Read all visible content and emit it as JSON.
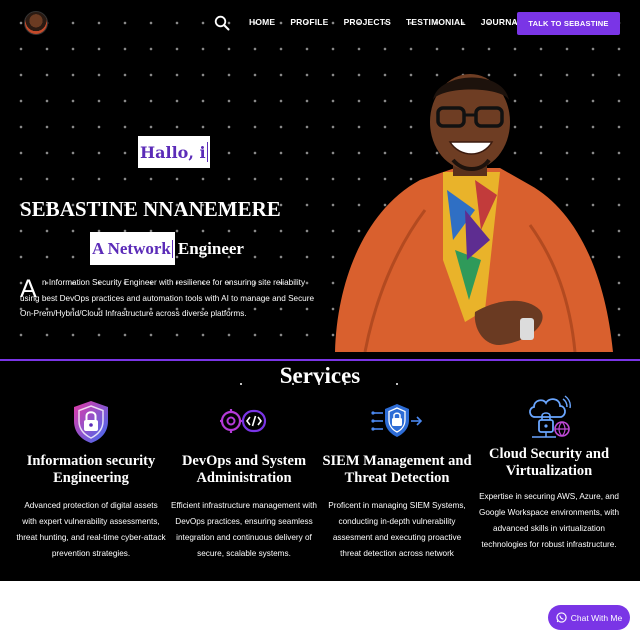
{
  "nav": {
    "links": [
      "HOME",
      "PROFILE",
      "PROJECTS",
      "TESTIMONIAL",
      "JOURNALS"
    ],
    "cta": "TALK TO SEBASTINE"
  },
  "hero": {
    "greeting": "Hallo, i",
    "name": "SEBASTINE NNANEMERE",
    "role_typed": "A Network",
    "role_rest": "Engineer",
    "bio_dropcap": "A",
    "bio_text": "n Information Security Engineer with resilience for ensuring site reliability using best DevOps practices and automation tools with AI to manage and Secure On-Prem/Hybrid/Cloud Infrastructure across diverse platforms."
  },
  "services": {
    "title": "Services",
    "cards": [
      {
        "icon": "shield-lock-icon",
        "title": "Information security Engineering",
        "desc": "Advanced protection of digital assets with expert vulnerability assessments, threat hunting, and real-time cyber-attack prevention strategies."
      },
      {
        "icon": "devops-code-icon",
        "title": "DevOps and System Administration",
        "desc": "Efficient infrastructure management with DevOps practices, ensuring seamless integration and continuous delivery of secure, scalable systems."
      },
      {
        "icon": "siem-shield-icon",
        "title": "SIEM Management and Threat Detection",
        "desc": "Proficent in managing SIEM Systems, conducting in-depth vulnerability assesment and executing proactive threat detection across network"
      },
      {
        "icon": "cloud-security-icon",
        "title": "Cloud Security and Virtualization",
        "desc": "Expertise in securing AWS, Azure, and Google Workspace environments, with advanced skills in virtualization technologies for robust infrastructure."
      }
    ]
  },
  "chat": {
    "label": "Chat With Me"
  },
  "colors": {
    "accent": "#7a35e6",
    "background": "#000000",
    "highlight_text": "#5b2bb8"
  }
}
